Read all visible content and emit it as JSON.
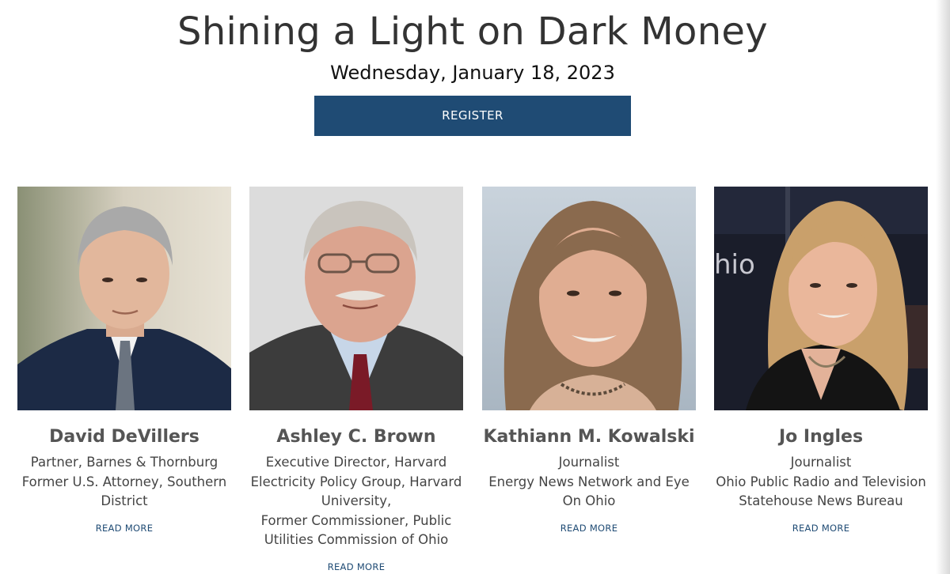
{
  "event": {
    "title": "Shining a Light on Dark Money",
    "date": "Wednesday, January 18, 2023",
    "register_label": "REGISTER"
  },
  "speakers": [
    {
      "name": "David DeVillers",
      "role_lines": [
        "Partner, Barnes & Thornburg",
        "Former U.S. Attorney, Southern",
        "District"
      ],
      "read_more": "READ MORE"
    },
    {
      "name": "Ashley C. Brown",
      "role_lines": [
        "Executive Director, Harvard",
        "Electricity Policy Group, Harvard",
        "University,",
        "Former Commissioner, Public",
        "Utilities Commission of Ohio"
      ],
      "read_more": "READ MORE"
    },
    {
      "name": "Kathiann M. Kowalski",
      "role_lines": [
        "Journalist",
        "Energy News Network and Eye",
        "On Ohio"
      ],
      "read_more": "READ MORE"
    },
    {
      "name": "Jo Ingles",
      "role_lines": [
        "Journalist",
        "Ohio Public Radio and Television",
        "Statehouse News Bureau"
      ],
      "read_more": "READ MORE"
    }
  ],
  "photo_backdrop_text": "hio",
  "colors": {
    "brand_navy": "#1f4b74",
    "heading_gray": "#555555",
    "body_gray": "#444444"
  }
}
